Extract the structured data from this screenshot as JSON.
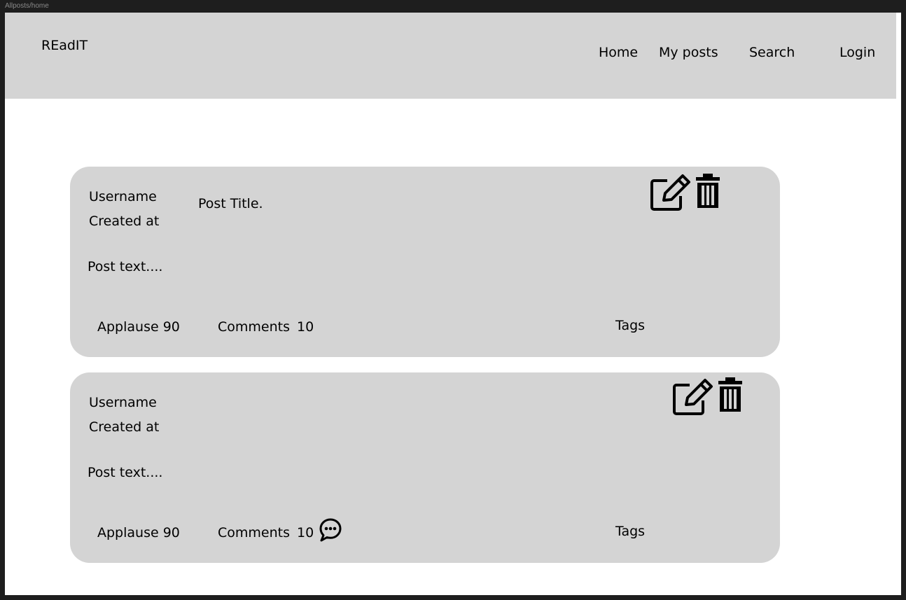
{
  "window": {
    "title": "Allposts/home"
  },
  "navbar": {
    "brand": "REadIT",
    "links": [
      {
        "label": "Home"
      },
      {
        "label": "My posts"
      },
      {
        "label": "Search"
      },
      {
        "label": "Login"
      }
    ]
  },
  "posts": [
    {
      "username": "Username",
      "created_at": "Created at",
      "title": "Post Title.",
      "text": "Post text....",
      "applause_label": "Applause 90",
      "comments_label": "Comments",
      "comments_count": "10",
      "tags_label": "Tags",
      "icons": [
        "edit-icon",
        "trash-icon"
      ]
    },
    {
      "username": "Username",
      "created_at": "Created at",
      "text": "Post text....",
      "applause_label": "Applause 90",
      "comments_label": "Comments",
      "comments_count": "10",
      "tags_label": "Tags",
      "icons": [
        "edit-icon",
        "trash-icon",
        "comment-bubble-icon"
      ]
    }
  ],
  "colors": {
    "navbar_bg": "#d4d4d4",
    "card_bg": "#d4d4d4",
    "page_bg": "#ffffff",
    "outer_bg": "#1e1e1e"
  }
}
